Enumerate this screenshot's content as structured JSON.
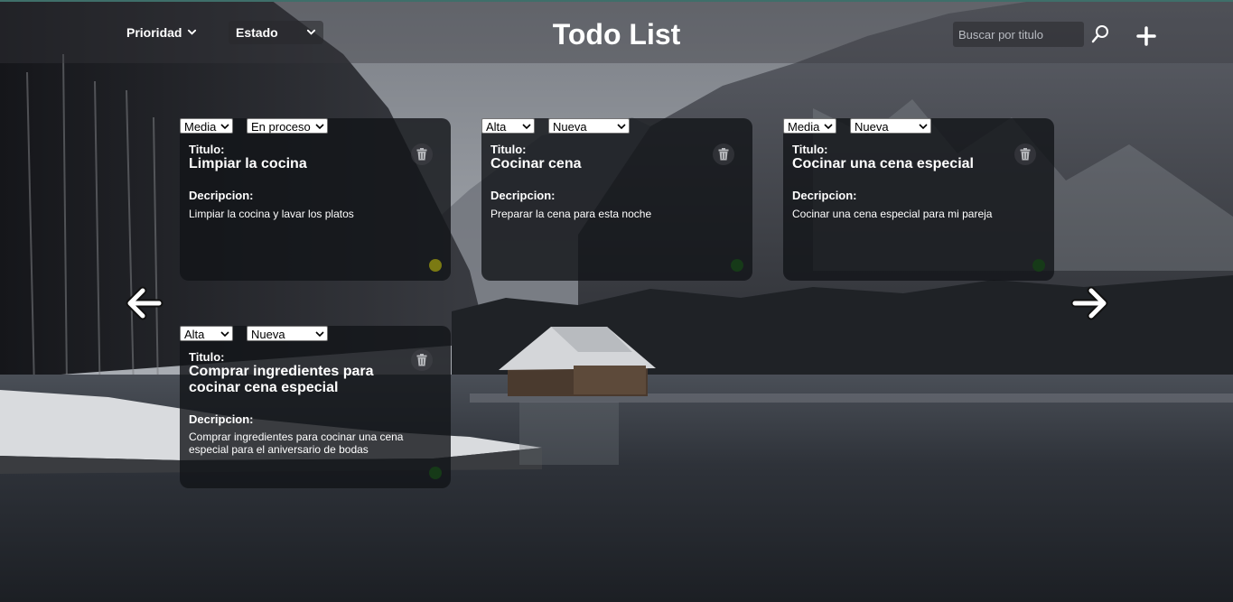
{
  "header": {
    "title": "Todo List",
    "filters": {
      "prioridad_label": "Prioridad",
      "estado_label": "Estado"
    },
    "search": {
      "placeholder": "Buscar por titulo",
      "value": ""
    },
    "icons": {
      "search": "search-icon",
      "add": "plus-icon"
    }
  },
  "labels": {
    "titulo": "Titulo:",
    "descripcion": "Decripcion:"
  },
  "tasks": [
    {
      "prioridad": "Media",
      "estado": "En proceso",
      "titulo": "Limpiar la cocina",
      "descripcion": "Limpiar la cocina y lavar los platos",
      "status_color": "#7b7a12"
    },
    {
      "prioridad": "Alta",
      "estado": "Nueva",
      "titulo": "Cocinar cena",
      "descripcion": "Preparar la cena para esta noche",
      "status_color": "#163a18"
    },
    {
      "prioridad": "Media",
      "estado": "Nueva",
      "titulo": "Cocinar una cena especial",
      "descripcion": "Cocinar una cena especial para mi pareja",
      "status_color": "#163a18"
    },
    {
      "prioridad": "Alta",
      "estado": "Nueva",
      "titulo": "Comprar ingredientes para cocinar cena especial",
      "descripcion": "Comprar ingredientes para cocinar una cena especial para el aniversario de bodas",
      "status_color": "#163a18"
    }
  ],
  "navigation": {
    "prev_icon": "arrow-left-icon",
    "next_icon": "arrow-right-icon"
  },
  "colors": {
    "header_bg": "#37373c",
    "card_bg": "#121418",
    "text": "#ffffff",
    "status_en_proceso": "#7b7a12",
    "status_nueva": "#163a18"
  }
}
